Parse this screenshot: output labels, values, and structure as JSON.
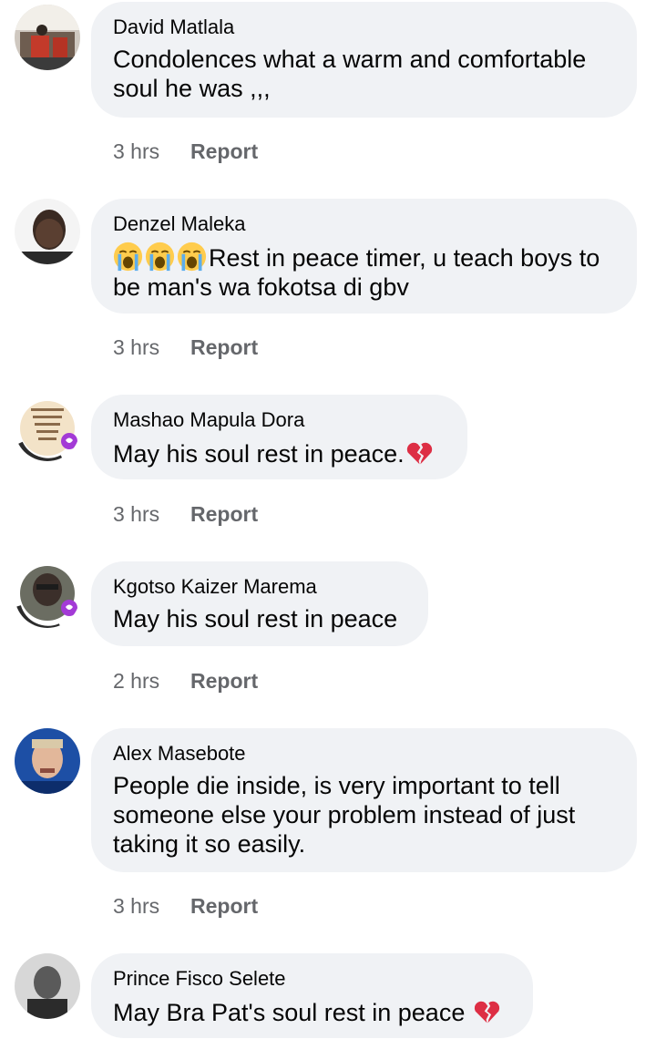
{
  "comments": [
    {
      "author": "David Matlala",
      "text": "Condolences what a warm and comfortable soul he was ,,,",
      "time": "3 hrs",
      "report": "Report",
      "avatar_icon": "profile-photo"
    },
    {
      "author": "Denzel Maleka",
      "text": "Rest in peace timer, u teach boys to be man's wa fokotsa di gbv",
      "emoji": "loudly-crying-face",
      "time": "3 hrs",
      "report": "Report",
      "avatar_icon": "profile-photo"
    },
    {
      "author": "Mashao Mapula Dora",
      "text": "May his soul rest in peace.",
      "emoji": "broken-heart",
      "time": "3 hrs",
      "report": "Report",
      "avatar_icon": "profile-photo-vaccine-frame"
    },
    {
      "author": "Kgotso Kaizer Marema",
      "text": "May his soul rest in peace",
      "time": "2 hrs",
      "report": "Report",
      "avatar_icon": "profile-photo-vaccine-frame"
    },
    {
      "author": "Alex Masebote",
      "text": "People die inside, is very important to tell someone else your problem instead of just taking it so easily.",
      "time": "3 hrs",
      "report": "Report",
      "avatar_icon": "profile-photo"
    },
    {
      "author": "Prince Fisco Selete",
      "text": "May Bra Pat's soul rest in peace",
      "emoji": "broken-heart",
      "time": "",
      "report": "",
      "avatar_icon": "profile-photo"
    }
  ],
  "colors": {
    "bubble_bg": "#f0f2f5",
    "meta_text": "#65676b",
    "body_text": "#050505",
    "broken_heart": "#dd2e44"
  }
}
